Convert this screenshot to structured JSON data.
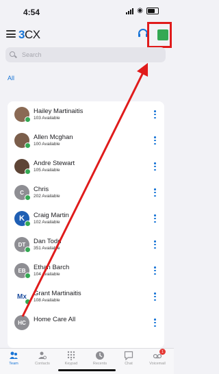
{
  "status_bar": {
    "time": "4:54"
  },
  "header": {
    "logo_num": "3",
    "logo_text": "CX"
  },
  "search": {
    "placeholder": "Search"
  },
  "filter": {
    "label": "All"
  },
  "contacts": [
    {
      "name": "Hailey Martinaitis",
      "status": "103 Available",
      "avatar_initials": "",
      "avatar_color": "#8a6a54"
    },
    {
      "name": "Allen Mcghan",
      "status": "100 Available",
      "avatar_initials": "",
      "avatar_color": "#7b5e4b"
    },
    {
      "name": "Andre Stewart",
      "status": "105 Available",
      "avatar_initials": "",
      "avatar_color": "#5e4536"
    },
    {
      "name": "Chris",
      "status": "202 Available",
      "avatar_initials": "C",
      "avatar_color": "#8e8e93"
    },
    {
      "name": "Craig Martin",
      "status": "102 Available",
      "avatar_initials": "K",
      "avatar_color": "#1f5fb4"
    },
    {
      "name": "Dan Todd",
      "status": "351 Available",
      "avatar_initials": "DT",
      "avatar_color": "#8e8e93"
    },
    {
      "name": "Ethan Barch",
      "status": "104 Available",
      "avatar_initials": "EB",
      "avatar_color": "#8e8e93"
    },
    {
      "name": "Grant Martinaitis",
      "status": "108 Available",
      "avatar_initials": "Mx",
      "avatar_color": "#ffffff"
    },
    {
      "name": "Home Care All",
      "status": "",
      "avatar_initials": "HC",
      "avatar_color": "#8e8e93"
    }
  ],
  "tabs": [
    {
      "label": "Team",
      "icon": "team-icon",
      "active": true
    },
    {
      "label": "Contacts",
      "icon": "contacts-icon"
    },
    {
      "label": "Keypad",
      "icon": "keypad-icon"
    },
    {
      "label": "Recents",
      "icon": "recents-icon"
    },
    {
      "label": "Chat",
      "icon": "chat-icon"
    },
    {
      "label": "Voicemail",
      "icon": "voicemail-icon",
      "badge": "1"
    }
  ],
  "colors": {
    "accent": "#1774d6",
    "available": "#34a853",
    "annotation": "#e01b1b"
  }
}
